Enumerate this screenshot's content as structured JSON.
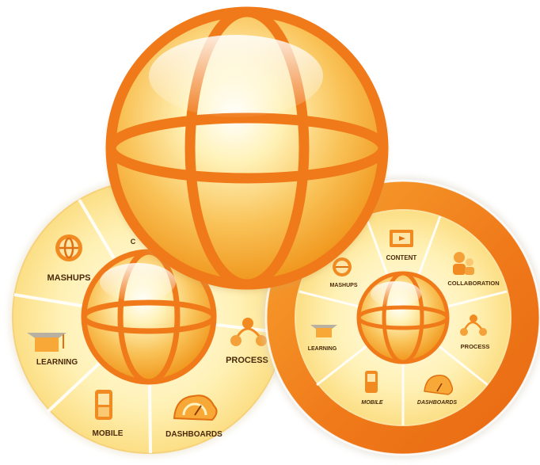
{
  "colors": {
    "orange": "#f07a1a",
    "orange_dark": "#e0660a",
    "gold": "#f7b733",
    "pale_yellow": "#fff4c4",
    "label_text": "#4a2a0a"
  },
  "left_wheel": {
    "segments": [
      {
        "label": "MASHUPS",
        "icon": "mashups-globe-icon"
      },
      {
        "label": "",
        "icon": ""
      },
      {
        "label": "PROCESS",
        "icon": "process-network-icon"
      },
      {
        "label": "DASHBOARDS",
        "icon": "dashboards-gauge-icon"
      },
      {
        "label": "MOBILE",
        "icon": "mobile-phone-icon"
      },
      {
        "label": "LEARNING",
        "icon": "graduation-cap-icon"
      }
    ],
    "hidden_label_fragment": "C"
  },
  "right_wheel": {
    "segments": [
      {
        "label": "CONTENT",
        "icon": "content-document-icon"
      },
      {
        "label": "COLLABORATION",
        "icon": "collaboration-people-icon"
      },
      {
        "label": "PROCESS",
        "icon": "process-network-icon"
      },
      {
        "label": "DASHBOARDS",
        "icon": "dashboards-gauge-icon"
      },
      {
        "label": "MOBILE",
        "icon": "mobile-phone-icon"
      },
      {
        "label": "LEARNING",
        "icon": "graduation-cap-icon"
      },
      {
        "label": "MASHUPS",
        "icon": "mashups-globe-icon"
      }
    ]
  }
}
